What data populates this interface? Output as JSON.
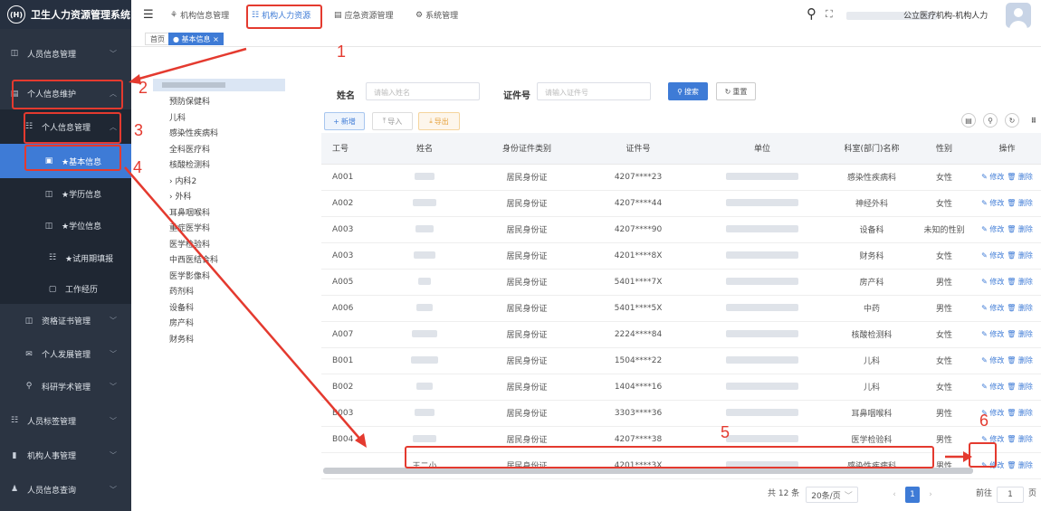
{
  "app": {
    "title": "卫生人力资源管理系统",
    "logo_text": "(H)"
  },
  "sidebar": {
    "items": [
      {
        "label": "人员信息管理"
      },
      {
        "label": "个人信息维护"
      },
      {
        "label": "个人信息管理"
      },
      {
        "label": "★基本信息"
      },
      {
        "label": "★学历信息"
      },
      {
        "label": "★学位信息"
      },
      {
        "label": "★试用期填报"
      },
      {
        "label": "工作经历"
      },
      {
        "label": "资格证书管理"
      },
      {
        "label": "个人发展管理"
      },
      {
        "label": "科研学术管理"
      },
      {
        "label": "人员标签管理"
      },
      {
        "label": "机构人事管理"
      },
      {
        "label": "人员信息查询"
      }
    ]
  },
  "topnav": {
    "tabs": [
      {
        "label": "机构信息管理"
      },
      {
        "label": "机构人力资源"
      },
      {
        "label": "应急资源管理"
      },
      {
        "label": "系统管理"
      }
    ],
    "user": "公立医疗机构-机构人力"
  },
  "breadcrumb": {
    "home": "首页",
    "current": "● 基本信息 ×"
  },
  "tree": {
    "items": [
      {
        "label": "预防保健科"
      },
      {
        "label": "儿科"
      },
      {
        "label": "感染性疾病科"
      },
      {
        "label": "全科医疗科"
      },
      {
        "label": "核酸检测科"
      },
      {
        "label": "› 内科2"
      },
      {
        "label": "› 外科"
      },
      {
        "label": "耳鼻咽喉科"
      },
      {
        "label": "重症医学科"
      },
      {
        "label": "医学检验科"
      },
      {
        "label": "中西医结合科"
      },
      {
        "label": "医学影像科"
      },
      {
        "label": "药剂科"
      },
      {
        "label": "设备科"
      },
      {
        "label": "房产科"
      },
      {
        "label": "财务科"
      }
    ]
  },
  "filter": {
    "name_label": "姓名",
    "name_placeholder": "请输入姓名",
    "id_label": "证件号",
    "id_placeholder": "请输入证件号",
    "search": "搜索",
    "reset": "重置"
  },
  "toolbar": {
    "add": "新增",
    "import": "导入",
    "export": "导出"
  },
  "table": {
    "headers": [
      "工号",
      "姓名",
      "身份证件类别",
      "证件号",
      "单位",
      "科室(部门)名称",
      "性别",
      "操作"
    ],
    "edit": "修改",
    "delete": "删除",
    "rows": [
      {
        "id": "A001",
        "name": "",
        "type": "居民身份证",
        "no": "4207****23",
        "dept": "感染性疾病科",
        "sex": "女性"
      },
      {
        "id": "A002",
        "name": "",
        "type": "居民身份证",
        "no": "4207****44",
        "dept": "神经外科",
        "sex": "女性"
      },
      {
        "id": "A003",
        "name": "",
        "type": "居民身份证",
        "no": "4207****90",
        "dept": "设备科",
        "sex": "未知的性别"
      },
      {
        "id": "A003",
        "name": "",
        "type": "居民身份证",
        "no": "4201****8X",
        "dept": "财务科",
        "sex": "女性"
      },
      {
        "id": "A005",
        "name": "",
        "type": "居民身份证",
        "no": "5401****7X",
        "dept": "房产科",
        "sex": "男性"
      },
      {
        "id": "A006",
        "name": "",
        "type": "居民身份证",
        "no": "5401****5X",
        "dept": "中药",
        "sex": "男性"
      },
      {
        "id": "A007",
        "name": "",
        "type": "居民身份证",
        "no": "2224****84",
        "dept": "核酸检测科",
        "sex": "女性"
      },
      {
        "id": "B001",
        "name": "",
        "type": "居民身份证",
        "no": "1504****22",
        "dept": "儿科",
        "sex": "女性"
      },
      {
        "id": "B002",
        "name": "",
        "type": "居民身份证",
        "no": "1404****16",
        "dept": "儿科",
        "sex": "女性"
      },
      {
        "id": "B003",
        "name": "",
        "type": "居民身份证",
        "no": "3303****36",
        "dept": "耳鼻咽喉科",
        "sex": "男性"
      },
      {
        "id": "B004",
        "name": "",
        "type": "居民身份证",
        "no": "4207****38",
        "dept": "医学检验科",
        "sex": "男性"
      },
      {
        "id": "",
        "name": "王二小",
        "type": "居民身份证",
        "no": "4201****3X",
        "dept": "感染性疾病科",
        "sex": "男性"
      }
    ]
  },
  "pagination": {
    "total": "共 12 条",
    "size": "20条/页",
    "page": "1",
    "goto": "前往",
    "goto_page": "1",
    "unit": "页"
  },
  "annotations": {
    "n1": "1",
    "n2": "2",
    "n3": "3",
    "n4": "4",
    "n5": "5",
    "n6": "6"
  },
  "colors": {
    "sidebar": "#2b3442",
    "accent": "#3e7bd6",
    "highlight": "#e43a2f",
    "export": "#e6a23c"
  }
}
